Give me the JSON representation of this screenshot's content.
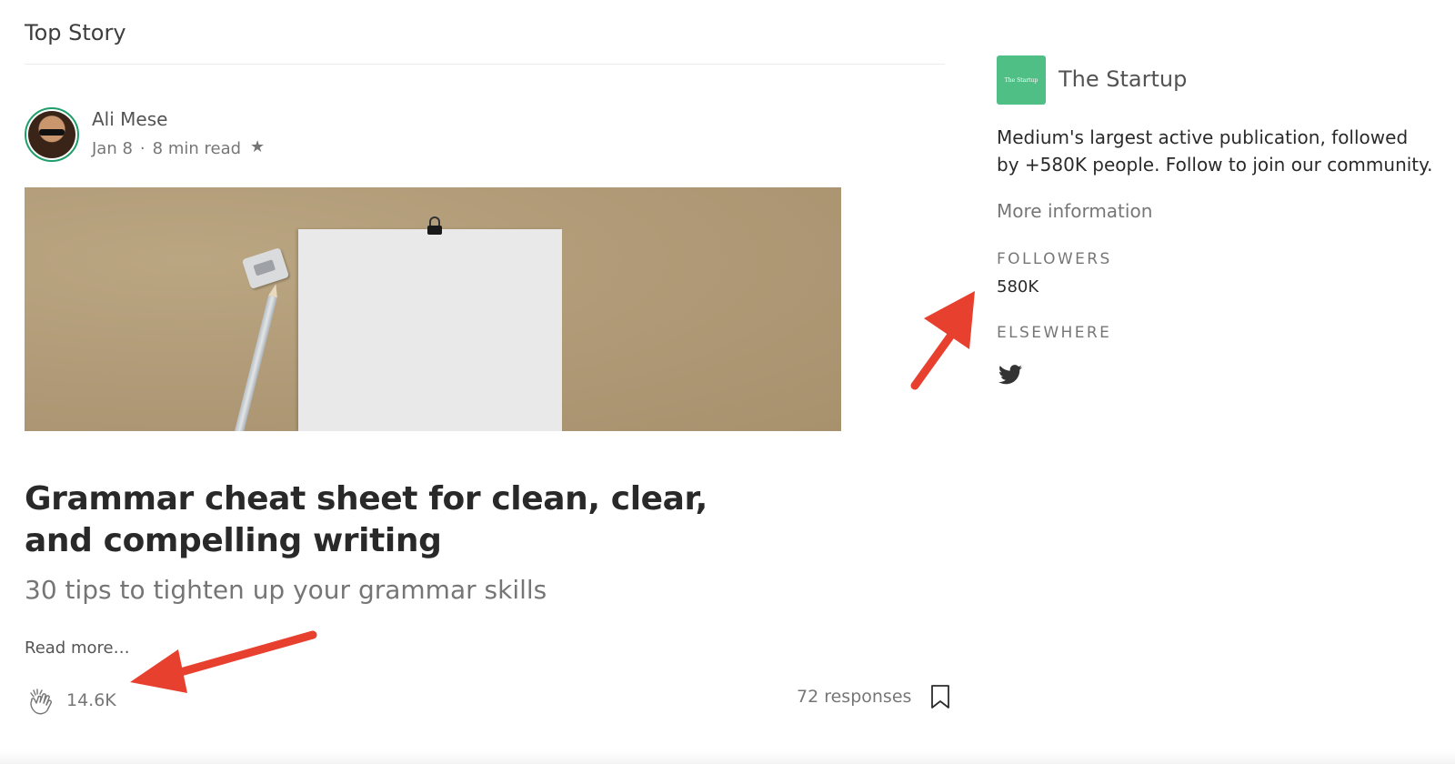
{
  "section": {
    "title": "Top Story"
  },
  "post": {
    "author": "Ali Mese",
    "date": "Jan 8",
    "separator": "·",
    "read_time": "8 min read",
    "star": "★",
    "title": "Grammar cheat sheet for clean, clear, and compelling writing",
    "subtitle": "30 tips to tighten up your grammar skills",
    "read_more": "Read more…",
    "claps": "14.6K",
    "responses": "72 responses"
  },
  "publication": {
    "logo_text": "The Startup",
    "name": "The Startup",
    "description": "Medium's largest active publication, followed by +580K people. Follow to join our community.",
    "more_info": "More information",
    "followers_label": "FOLLOWERS",
    "followers_count": "580K",
    "elsewhere_label": "ELSEWHERE",
    "social_icon": "twitter-icon",
    "logo_color": "#4fbf86"
  },
  "annotations": {
    "arrow_color": "#e8402f"
  },
  "colors": {
    "avatar_ring": "#1e9e6a"
  }
}
